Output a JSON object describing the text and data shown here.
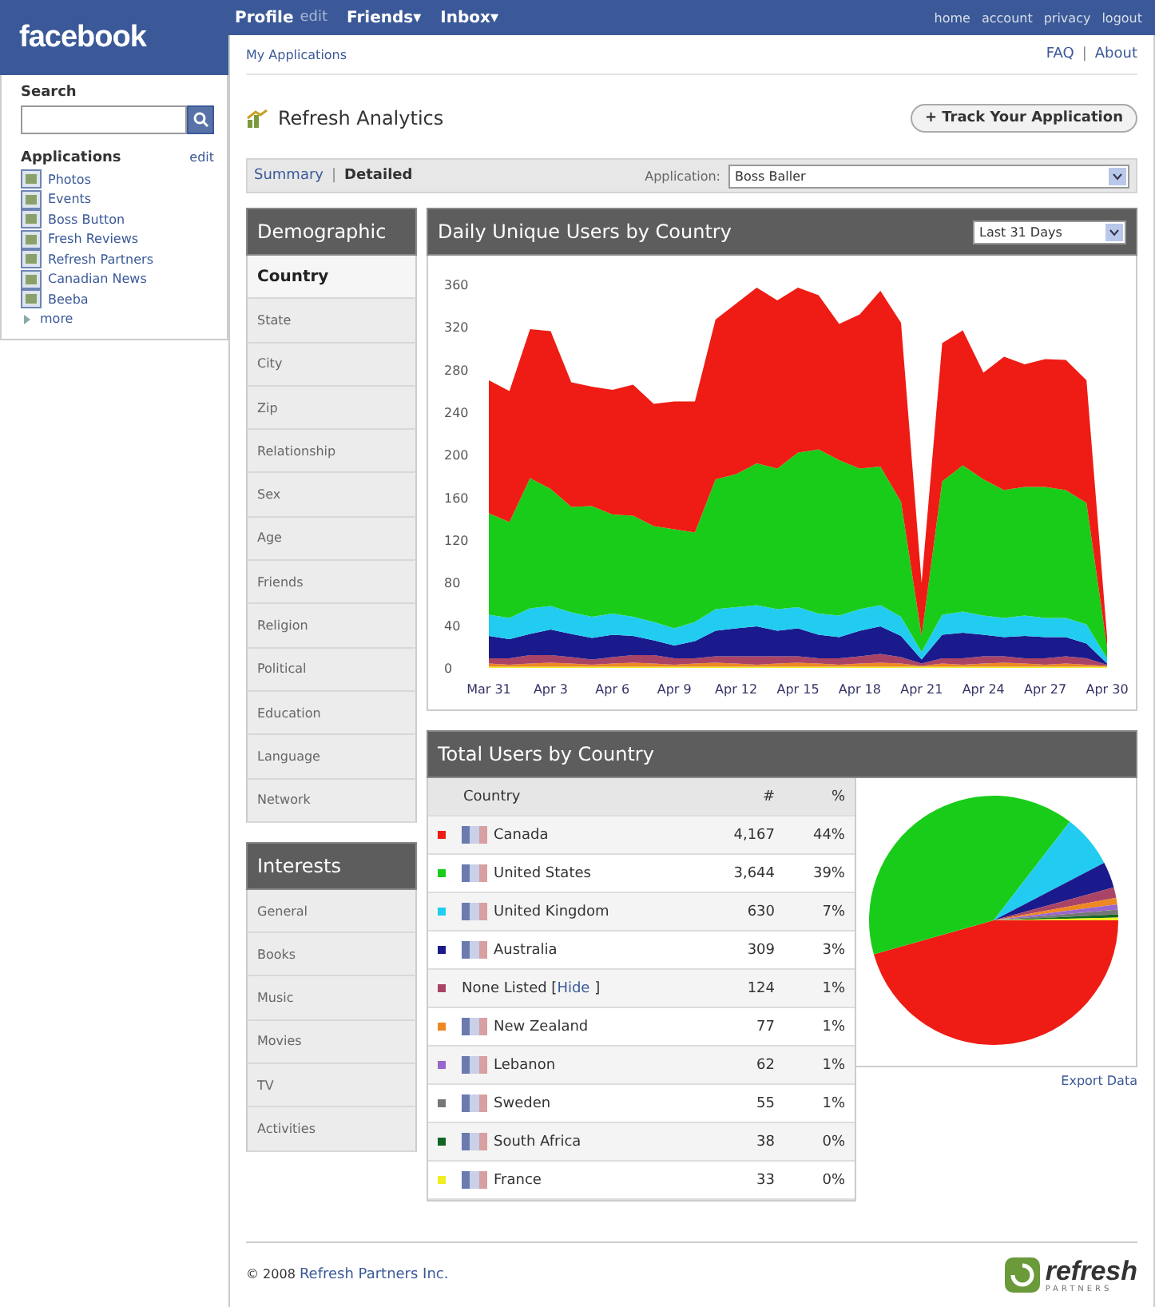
{
  "header": {
    "logo": "facebook",
    "nav": [
      {
        "label": "Profile",
        "caret": false
      },
      {
        "label": "edit",
        "caret": false,
        "kind": "minor"
      },
      {
        "label": "Friends",
        "caret": true
      },
      {
        "label": "Inbox",
        "caret": true
      }
    ],
    "nav_caret": "▾",
    "right_links": [
      "home",
      "account",
      "privacy",
      "logout"
    ]
  },
  "sidebar": {
    "search_label": "Search",
    "applications_label": "Applications",
    "edit": "edit",
    "apps": [
      "Photos",
      "Events",
      "Boss Button",
      "Fresh Reviews",
      "Refresh Partners",
      "Canadian News",
      "Beeba"
    ],
    "more": "more"
  },
  "breadcrumb": "My Applications",
  "help_links": [
    "FAQ",
    "About"
  ],
  "separator": "|",
  "title": "Refresh Analytics",
  "track_button": "+ Track Your Application",
  "view_tabs": [
    {
      "label": "Summary",
      "selected": false
    },
    {
      "label": "Detailed",
      "selected": true
    }
  ],
  "application_label": "Application:",
  "application_value": "Boss Baller",
  "demographic": {
    "title": "Demographic",
    "items": [
      {
        "label": "Country",
        "selected": true
      },
      {
        "label": "State",
        "selected": false
      },
      {
        "label": "City",
        "selected": false
      },
      {
        "label": "Zip",
        "selected": false
      },
      {
        "label": "Relationship",
        "selected": false
      },
      {
        "label": "Sex",
        "selected": false
      },
      {
        "label": "Age",
        "selected": false
      },
      {
        "label": "Friends",
        "selected": false
      },
      {
        "label": "Religion",
        "selected": false
      },
      {
        "label": "Political",
        "selected": false
      },
      {
        "label": "Education",
        "selected": false
      },
      {
        "label": "Language",
        "selected": false
      },
      {
        "label": "Network",
        "selected": false
      }
    ]
  },
  "interests": {
    "title": "Interests",
    "items": [
      {
        "label": "General",
        "selected": false
      },
      {
        "label": "Books",
        "selected": false
      },
      {
        "label": "Music",
        "selected": false
      },
      {
        "label": "Movies",
        "selected": false
      },
      {
        "label": "TV",
        "selected": false
      },
      {
        "label": "Activities",
        "selected": false
      }
    ]
  },
  "daily_chart": {
    "title": "Daily Unique Users by Country",
    "range": "Last 31 Days",
    "chart_data": {
      "type": "area",
      "stacked": true,
      "categories": [
        "Mar 31",
        null,
        null,
        "Apr 3",
        null,
        null,
        "Apr 6",
        null,
        null,
        "Apr 9",
        null,
        null,
        "Apr 12",
        null,
        null,
        "Apr 15",
        null,
        null,
        "Apr 18",
        null,
        null,
        "Apr 21",
        null,
        null,
        "Apr 24",
        null,
        null,
        "Apr 27",
        null,
        null,
        "Apr 30"
      ],
      "yticks": [
        0,
        40,
        80,
        120,
        160,
        200,
        240,
        280,
        320,
        360
      ],
      "ylim": [
        0,
        360
      ],
      "series": [
        {
          "color": "#eeee22",
          "values": [
            1,
            1,
            1,
            1,
            1,
            1,
            1,
            1,
            1,
            1,
            1,
            1,
            1,
            1,
            1,
            1,
            1,
            1,
            1,
            1,
            1,
            1,
            1,
            1,
            1,
            1,
            1,
            1,
            1,
            1,
            1
          ]
        },
        {
          "color": "#ee8822",
          "values": [
            3,
            2,
            3,
            4,
            3,
            2,
            3,
            4,
            3,
            2,
            3,
            4,
            3,
            2,
            3,
            4,
            3,
            2,
            3,
            4,
            3,
            1,
            3,
            2,
            3,
            4,
            3,
            2,
            3,
            2,
            1
          ]
        },
        {
          "color": "#aa4466",
          "values": [
            5,
            6,
            8,
            7,
            6,
            5,
            6,
            7,
            8,
            6,
            5,
            6,
            7,
            8,
            7,
            6,
            5,
            6,
            7,
            8,
            6,
            2,
            5,
            6,
            7,
            6,
            5,
            6,
            7,
            6,
            1
          ]
        },
        {
          "color": "#1a1a8c",
          "values": [
            21,
            18,
            20,
            24,
            22,
            20,
            21,
            18,
            14,
            12,
            16,
            24,
            26,
            28,
            24,
            26,
            22,
            20,
            24,
            26,
            20,
            4,
            22,
            24,
            20,
            18,
            21,
            20,
            18,
            14,
            1
          ]
        },
        {
          "color": "#22ccf0",
          "values": [
            20,
            20,
            24,
            22,
            20,
            20,
            20,
            18,
            17,
            16,
            18,
            20,
            20,
            20,
            20,
            20,
            20,
            20,
            20,
            20,
            18,
            7,
            19,
            20,
            18,
            18,
            19,
            18,
            18,
            18,
            5
          ]
        },
        {
          "color": "#19cc19",
          "values": [
            95,
            90,
            122,
            110,
            99,
            104,
            93,
            95,
            90,
            93,
            84,
            122,
            125,
            133,
            132,
            145,
            154,
            146,
            132,
            130,
            108,
            15,
            125,
            137,
            128,
            120,
            121,
            123,
            120,
            114,
            10
          ]
        },
        {
          "color": "#ee1c14",
          "values": [
            125,
            123,
            140,
            148,
            117,
            112,
            117,
            123,
            115,
            120,
            123,
            150,
            160,
            165,
            158,
            155,
            145,
            128,
            145,
            165,
            168,
            50,
            130,
            127,
            100,
            125,
            115,
            120,
            122,
            115,
            10
          ]
        }
      ]
    }
  },
  "total_table": {
    "title": "Total Users by Country",
    "columns": [
      "Country",
      "#",
      "%"
    ],
    "rows": [
      {
        "color": "#ee1c14",
        "flag": true,
        "name": "Canada",
        "count": "4,167",
        "pct": "44%"
      },
      {
        "color": "#19cc19",
        "flag": true,
        "name": "United States",
        "count": "3,644",
        "pct": "39%"
      },
      {
        "color": "#22ccf0",
        "flag": true,
        "name": "United Kingdom",
        "count": "630",
        "pct": "7%"
      },
      {
        "color": "#1a1a8c",
        "flag": true,
        "name": "Australia",
        "count": "309",
        "pct": "3%"
      },
      {
        "color": "#aa4466",
        "flag": false,
        "name": "None Listed [",
        "link": "Hide",
        "after": "]",
        "count": "124",
        "pct": "1%"
      },
      {
        "color": "#ee8822",
        "flag": true,
        "name": "New Zealand",
        "count": "77",
        "pct": "1%"
      },
      {
        "color": "#9966cc",
        "flag": true,
        "name": "Lebanon",
        "count": "62",
        "pct": "1%"
      },
      {
        "color": "#777777",
        "flag": true,
        "name": "Sweden",
        "count": "55",
        "pct": "1%"
      },
      {
        "color": "#116622",
        "flag": true,
        "name": "South Africa",
        "count": "38",
        "pct": "0%"
      },
      {
        "color": "#eeee22",
        "flag": true,
        "name": "France",
        "count": "33",
        "pct": "0%"
      }
    ],
    "export": "Export Data"
  },
  "footer": {
    "copyright": "© 2008",
    "company": "Refresh Partners Inc.",
    "logo": "refresh",
    "logo_sub": "PARTNERS"
  }
}
